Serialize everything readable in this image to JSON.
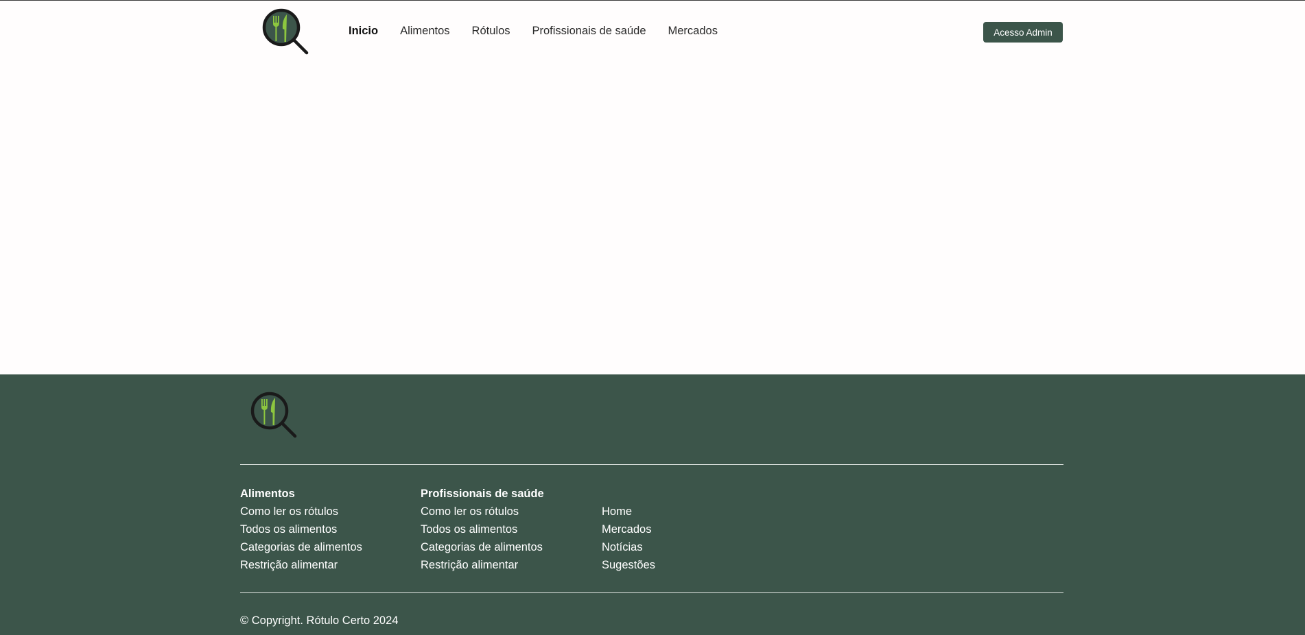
{
  "header": {
    "logo": "magnifier-fork-knife-logo",
    "nav": [
      {
        "label": "Inicio",
        "active": true
      },
      {
        "label": "Alimentos",
        "active": false
      },
      {
        "label": "Rótulos",
        "active": false
      },
      {
        "label": "Profissionais de saúde",
        "active": false
      },
      {
        "label": "Mercados",
        "active": false
      }
    ],
    "admin_button": "Acesso Admin"
  },
  "footer": {
    "logo": "magnifier-fork-knife-logo",
    "col1": {
      "heading": "Alimentos",
      "links": [
        "Como ler os rótulos",
        "Todos os alimentos",
        "Categorias de alimentos",
        "Restrição alimentar"
      ]
    },
    "col2": {
      "heading": "Profissionais de saúde",
      "links": [
        "Como ler os rótulos",
        "Todos os alimentos",
        "Categorias de alimentos",
        "Restrição alimentar"
      ]
    },
    "col3": {
      "links": [
        "Home",
        "Mercados",
        "Notícias",
        "Sugestões"
      ]
    },
    "copyright": "© Copyright. Rótulo Certo 2024"
  },
  "colors": {
    "brand_green": "#3c554a",
    "accent_green": "#8dc63f",
    "page_bg": "#fffdfd"
  }
}
